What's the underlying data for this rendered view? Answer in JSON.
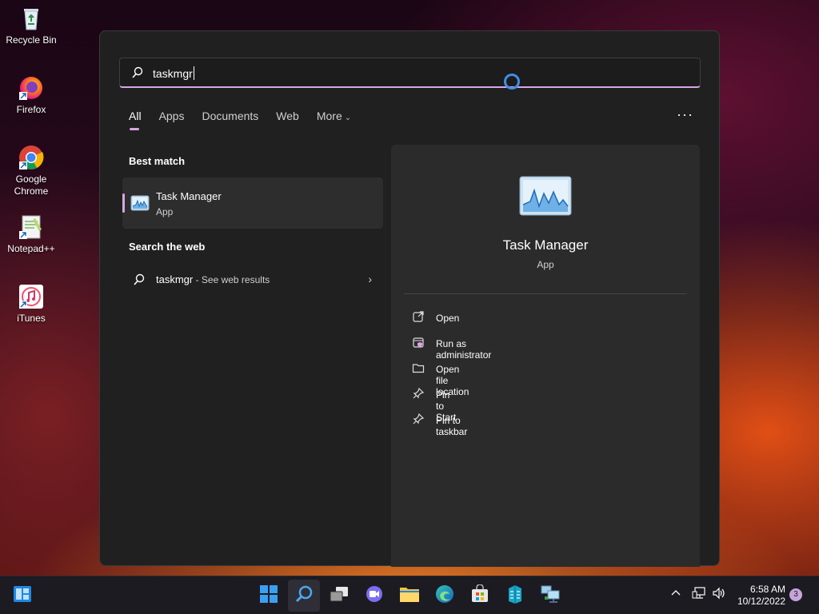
{
  "desktop": {
    "icons": [
      {
        "label": "Recycle Bin"
      },
      {
        "label": "Firefox"
      },
      {
        "label": "Google Chrome"
      },
      {
        "label": "Notepad++"
      },
      {
        "label": "iTunes"
      }
    ]
  },
  "search": {
    "query": "taskmgr",
    "tabs": [
      "All",
      "Apps",
      "Documents",
      "Web",
      "More"
    ],
    "active_tab": "All",
    "more_menu_icon": "ellipsis-icon",
    "best_match_title": "Best match",
    "best_match": {
      "name": "Task Manager",
      "type": "App"
    },
    "web_title": "Search the web",
    "web_result": {
      "query": "taskmgr",
      "suffix": " - See web results"
    }
  },
  "preview": {
    "name": "Task Manager",
    "type": "App",
    "actions": [
      {
        "label": "Open",
        "icon": "open-external-icon"
      },
      {
        "label": "Run as administrator",
        "icon": "shield-admin-icon"
      },
      {
        "label": "Open file location",
        "icon": "folder-icon"
      },
      {
        "label": "Pin to Start",
        "icon": "pin-icon"
      },
      {
        "label": "Pin to taskbar",
        "icon": "pin-icon"
      }
    ]
  },
  "taskbar": {
    "apps": [
      "Start",
      "Search",
      "Task View",
      "Chat",
      "File Explorer",
      "Edge",
      "Microsoft Store",
      "Server Manager",
      "Network"
    ],
    "clock_time": "6:58 AM",
    "clock_date": "10/12/2022",
    "notification_count": "3"
  },
  "colors": {
    "accent": "#d9a6e3",
    "panel_bg": "#202020",
    "preview_bg": "#2b2b2b",
    "spinner": "#3f8fe6"
  }
}
